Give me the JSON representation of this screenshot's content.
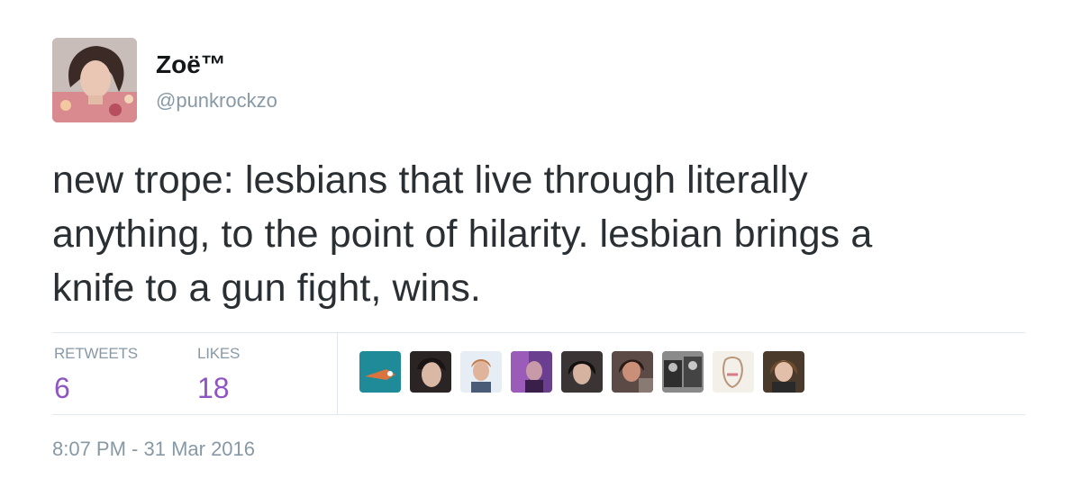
{
  "user": {
    "display_name": "Zoë™",
    "handle": "@punkrockzo"
  },
  "tweet": {
    "text_lines": [
      "new trope: lesbians that live through literally",
      "anything, to the point of hilarity. lesbian brings a",
      "knife to a gun fight, wins."
    ],
    "timestamp": "8:07 PM - 31 Mar 2016"
  },
  "stats": {
    "retweets_label": "RETWEETS",
    "retweets_count": "6",
    "likes_label": "LIKES",
    "likes_count": "18"
  },
  "colors": {
    "accent": "#8e55c3",
    "muted": "#8899a6",
    "text": "#292f33"
  }
}
